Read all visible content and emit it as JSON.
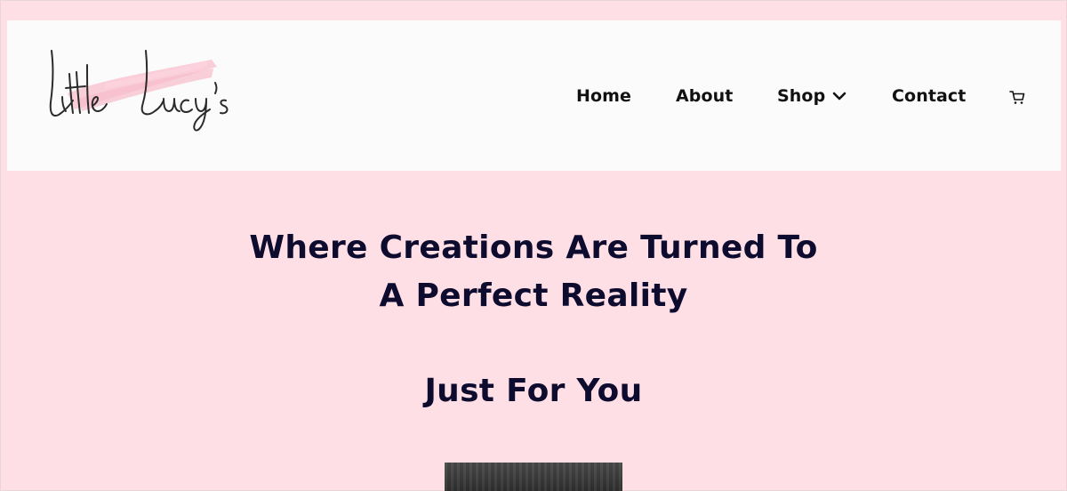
{
  "header": {
    "logo_text": "Little Lucy's",
    "nav": {
      "home": "Home",
      "about": "About",
      "shop": "Shop",
      "contact": "Contact"
    },
    "icons": {
      "shop_dropdown": "chevron-down-icon",
      "cart": "cart-icon"
    }
  },
  "hero": {
    "headline_line1": "Where Creations Are Turned To",
    "headline_line2": "A Perfect Reality",
    "subheadline": "Just For You"
  },
  "colors": {
    "page_background": "#ffdfe6",
    "header_background": "#fbfbfb",
    "heading_text": "#0d0b2e",
    "nav_text": "#111111",
    "logo_brush": "#f9c6d2"
  }
}
